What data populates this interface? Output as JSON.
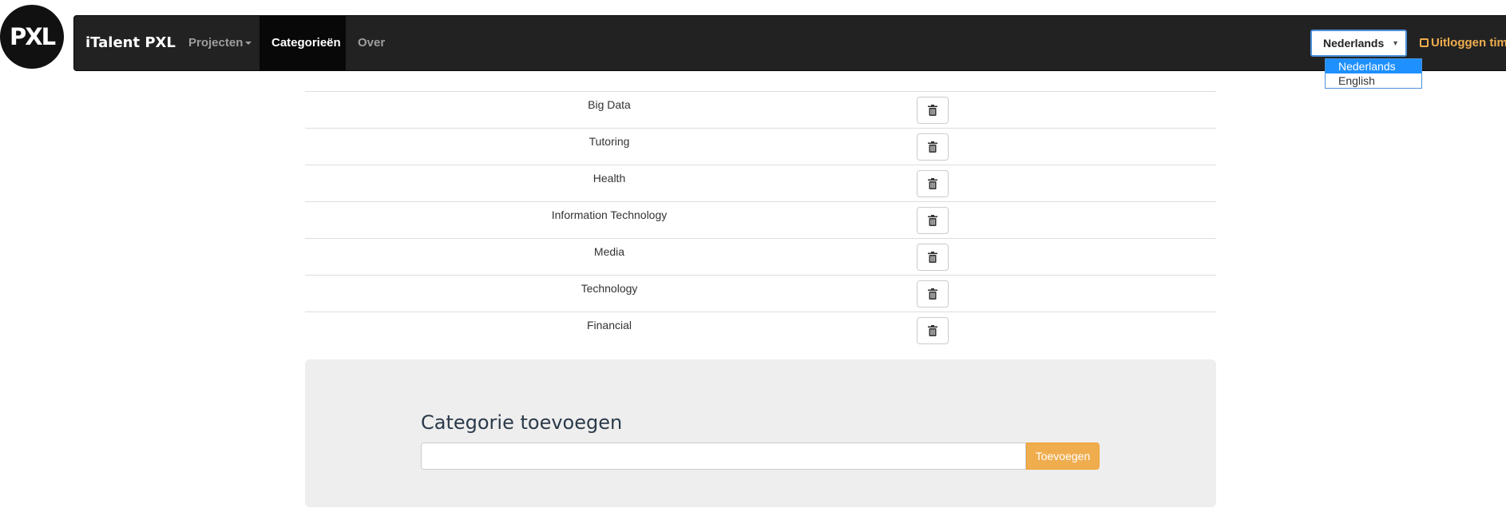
{
  "logo": {
    "text": "PXL"
  },
  "navbar": {
    "brand": "iTalent PXL",
    "links": [
      {
        "label": "Projecten",
        "dropdown": true
      },
      {
        "label": "Categorieën",
        "active": true
      },
      {
        "label": "Over"
      }
    ],
    "language_select": {
      "value": "Nederlands",
      "options": [
        "Nederlands",
        "English"
      ]
    },
    "logout_label": "Uitloggen tim"
  },
  "categories": [
    "Big Data",
    "Tutoring",
    "Health",
    "Information Technology",
    "Media",
    "Technology",
    "Financial"
  ],
  "add_panel": {
    "title": "Categorie toevoegen",
    "input_value": "",
    "button_label": "Toevoegen"
  },
  "colors": {
    "navbar_bg": "#222222",
    "accent": "#f0ad4e",
    "select_highlight": "#1e90ff",
    "panel_bg": "#eeeeee"
  }
}
